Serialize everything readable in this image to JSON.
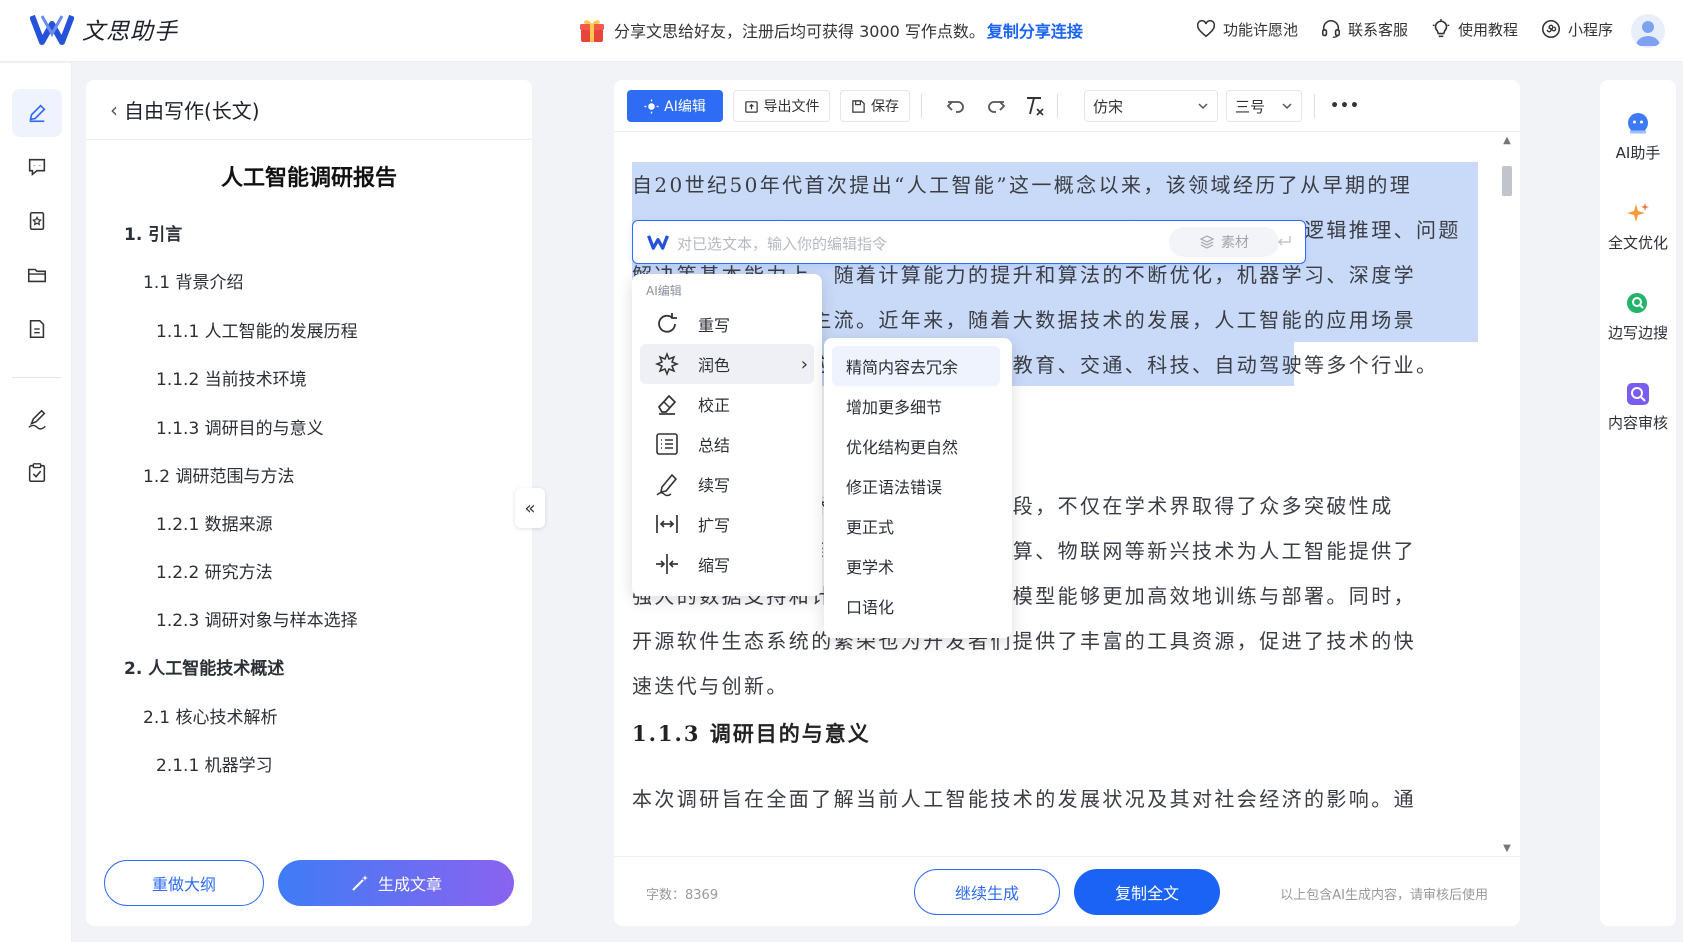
{
  "app": {
    "name": "文思助手",
    "promo_text": "分享文思给好友，注册后均可获得 3000 写作点数。",
    "promo_link": "复制分享连接",
    "top_links": [
      {
        "label": "功能许愿池",
        "icon": "heart-icon"
      },
      {
        "label": "联系客服",
        "icon": "headset-icon"
      },
      {
        "label": "使用教程",
        "icon": "lightbulb-icon"
      },
      {
        "label": "小程序",
        "icon": "miniprogram-icon"
      }
    ],
    "accent": "#1a63f5"
  },
  "rail": {
    "items": [
      "pen-icon",
      "comment-icon",
      "bookmark-icon",
      "folder-icon",
      "document-icon",
      "signature-icon",
      "clipboard-check-icon"
    ],
    "active_index": 0
  },
  "outline": {
    "back_label": "自由写作(长文)",
    "doc_title": "人工智能调研报告",
    "items": [
      {
        "level": 1,
        "text": "1. 引言"
      },
      {
        "level": 2,
        "text": "1.1 背景介绍"
      },
      {
        "level": 3,
        "text": "1.1.1 人工智能的发展历程"
      },
      {
        "level": 3,
        "text": "1.1.2 当前技术环境"
      },
      {
        "level": 3,
        "text": "1.1.3 调研目的与意义"
      },
      {
        "level": 2,
        "text": "1.2 调研范围与方法"
      },
      {
        "level": 3,
        "text": "1.2.1 数据来源"
      },
      {
        "level": 3,
        "text": "1.2.2 研究方法"
      },
      {
        "level": 3,
        "text": "1.2.3 调研对象与样本选择"
      },
      {
        "level": 1,
        "text": "2. 人工智能技术概述"
      },
      {
        "level": 2,
        "text": "2.1 核心技术解析"
      },
      {
        "level": 3,
        "text": "2.1.1 机器学习"
      }
    ],
    "redo_label": "重做大纲",
    "generate_label": "生成文章",
    "collapse_label": "«"
  },
  "toolbar": {
    "ai_edit": "AI编辑",
    "export": "导出文件",
    "save": "保存",
    "font": "仿宋",
    "size": "三号",
    "more": "•••"
  },
  "content": {
    "para1_lines": [
      "自20世纪50年代首次提出“人工智能”这一概念以来，该领域经历了从早期的理",
      "论探索到现代应用的多次浪潮。早期的人工智能研究主要集中在符号逻辑推理、问题",
      "解决等基本能力上，随着计算能力的提升和算法的不断优化，机器学习、深度学",
      "习等技术逐渐成为主流。近年来，随着大数据技术的发展，人工智能的应用场景",
      "不断拓展，已广泛应用于医疗、金融、教育、交通、科技、自动驾驶等多个行业。"
    ],
    "para2_lines": [
      "当前，人工智能技术正处于快速发展阶段，不仅在学术界取得了众多突破性成",
      "果，在产业界也得到了广泛应用。云计算、物联网等新兴技术为人工智能提供了",
      "强大的数据支持和计算资源，使得算法模型能够更加高效地训练与部署。同时，",
      "开源软件生态系统的繁荣也为开发者们提供了丰富的工具资源，促进了技术的快",
      "速迭代与创新。"
    ],
    "heading": "1.1.3  调研目的与意义",
    "para3_line": "本次调研旨在全面了解当前人工智能技术的发展状况及其对社会经济的影响。通",
    "selection_color": "#c9daf8"
  },
  "ai_input": {
    "placeholder": "对已选文本，输入你的编辑指令",
    "material_label": "素材"
  },
  "ai_menu": {
    "caption": "AI编辑",
    "items": [
      {
        "label": "重写",
        "icon": "rewrite-icon"
      },
      {
        "label": "润色",
        "icon": "polish-icon"
      },
      {
        "label": "校正",
        "icon": "eraser-icon"
      },
      {
        "label": "总结",
        "icon": "list-icon"
      },
      {
        "label": "续写",
        "icon": "continue-write-icon"
      },
      {
        "label": "扩写",
        "icon": "expand-icon"
      },
      {
        "label": "缩写",
        "icon": "shrink-icon"
      }
    ],
    "active_index": 1
  },
  "sub_menu": {
    "items": [
      "精简内容去冗余",
      "增加更多细节",
      "优化结构更自然",
      "修正语法错误",
      "更正式",
      "更学术",
      "口语化"
    ],
    "active_index": 0
  },
  "footer": {
    "word_count": "字数：8369",
    "continue_label": "继续生成",
    "copy_label": "复制全文",
    "note": "以上包含AI生成内容，请审核后使用"
  },
  "right_rail": {
    "items": [
      {
        "label": "AI助手",
        "icon": "ai-assistant-icon"
      },
      {
        "label": "全文优化",
        "icon": "sparkle-icon"
      },
      {
        "label": "边写边搜",
        "icon": "search-write-icon"
      },
      {
        "label": "内容审核",
        "icon": "review-icon"
      }
    ]
  }
}
